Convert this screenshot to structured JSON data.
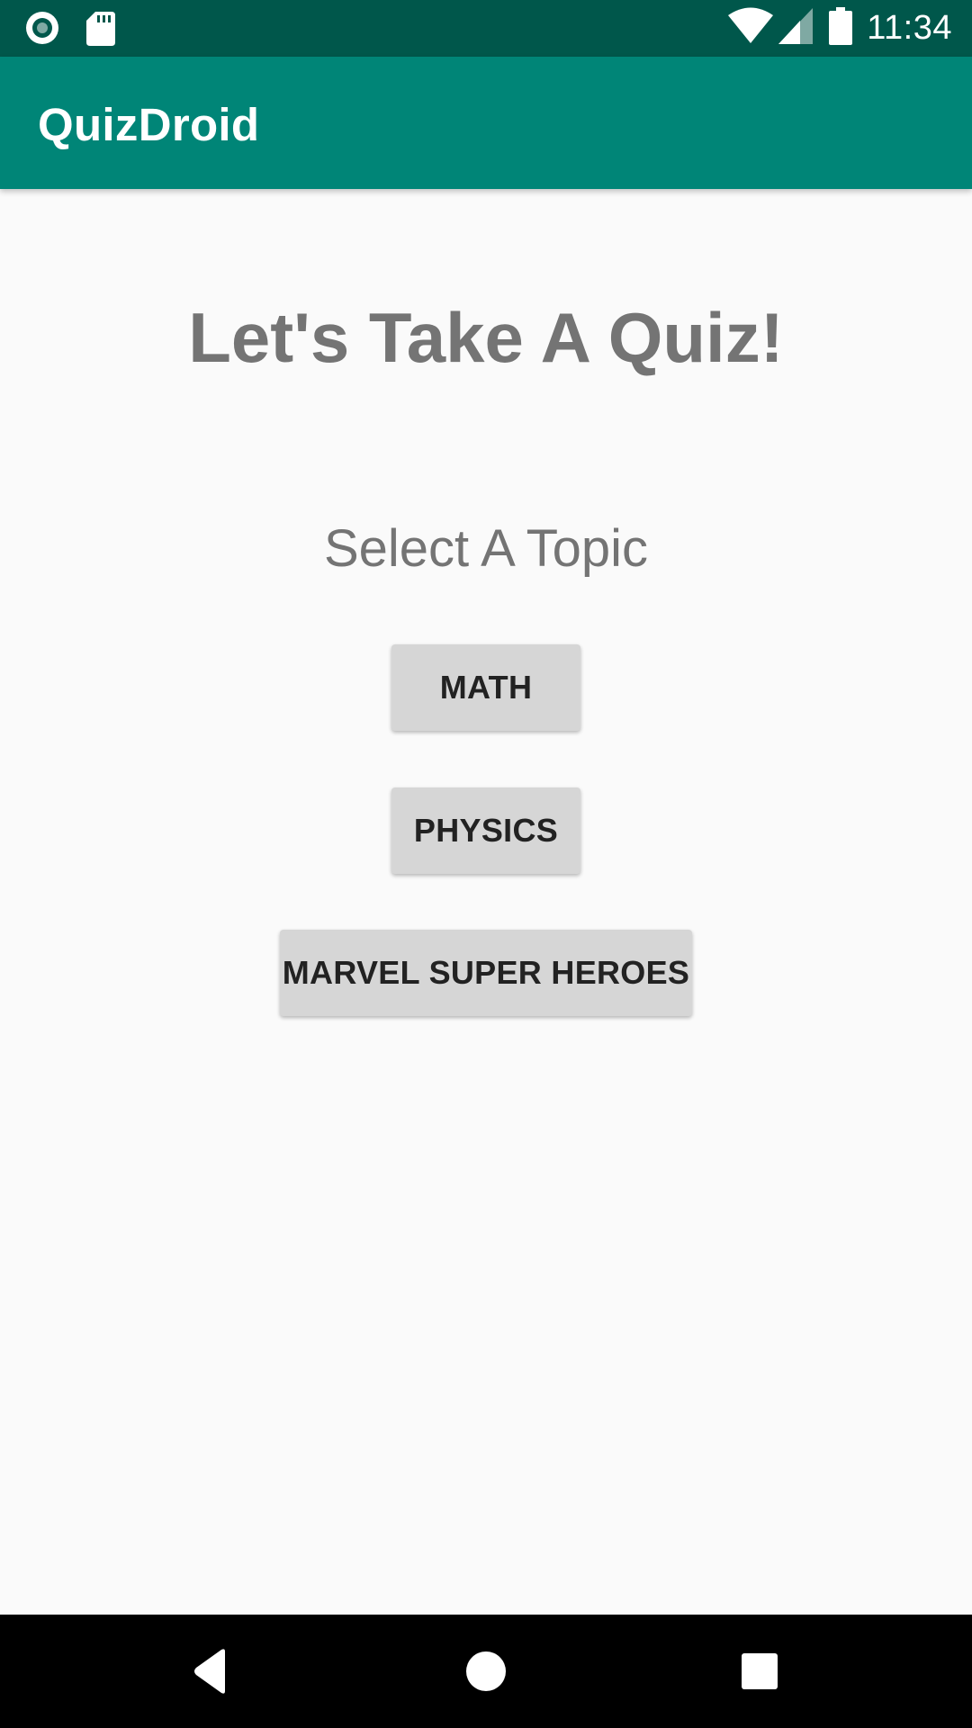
{
  "status_bar": {
    "time": "11:34",
    "icons": [
      "record-icon",
      "sd-card-icon",
      "wifi-icon",
      "cell-signal-icon",
      "battery-icon"
    ]
  },
  "app_bar": {
    "title": "QuizDroid"
  },
  "main": {
    "headline": "Let's Take A Quiz!",
    "subheading": "Select A Topic",
    "topics": [
      {
        "label": "MATH"
      },
      {
        "label": "PHYSICS"
      },
      {
        "label": "MARVEL SUPER HEROES"
      }
    ]
  },
  "nav_bar": {
    "icons": [
      "back-icon",
      "home-icon",
      "recents-icon"
    ]
  },
  "colors": {
    "status_bar": "#00574b",
    "app_bar": "#008577",
    "background": "#fafafa",
    "button": "#d6d6d6",
    "heading_text": "#747474"
  }
}
